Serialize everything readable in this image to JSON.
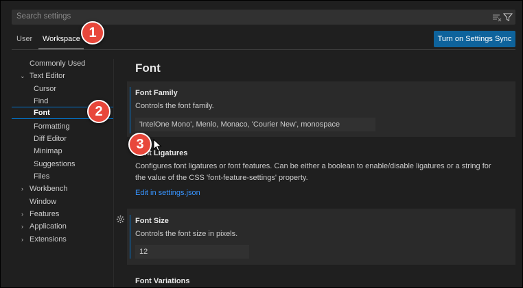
{
  "search": {
    "placeholder": "Search settings"
  },
  "tabs": {
    "user": "User",
    "workspace": "Workspace"
  },
  "sync_button": "Turn on Settings Sync",
  "nav": {
    "commonly_used": "Commonly Used",
    "text_editor": "Text Editor",
    "cursor": "Cursor",
    "find": "Find",
    "font": "Font",
    "formatting": "Formatting",
    "diff_editor": "Diff Editor",
    "minimap": "Minimap",
    "suggestions": "Suggestions",
    "files": "Files",
    "workbench": "Workbench",
    "window": "Window",
    "features": "Features",
    "application": "Application",
    "extensions": "Extensions"
  },
  "section_title": "Font",
  "settings": {
    "font_family": {
      "title": "Font Family",
      "desc": "Controls the font family.",
      "value": "'IntelOne Mono', Menlo, Monaco, 'Courier New', monospace"
    },
    "font_ligatures": {
      "title": "Font Ligatures",
      "desc1": "Configures font ligatures or font features. Can be either a boolean to enable/disable ligatures or a string for",
      "desc2": "the value of the CSS 'font-feature-settings' property.",
      "link": "Edit in settings.json"
    },
    "font_size": {
      "title": "Font Size",
      "desc": "Controls the font size in pixels.",
      "value": "12"
    },
    "font_variations": {
      "title": "Font Variations"
    }
  },
  "callouts": [
    "1",
    "2",
    "3"
  ],
  "colors": {
    "accent": "#0078d4",
    "button": "#0e639c",
    "link": "#3794ff",
    "callout": "#e8473b"
  }
}
